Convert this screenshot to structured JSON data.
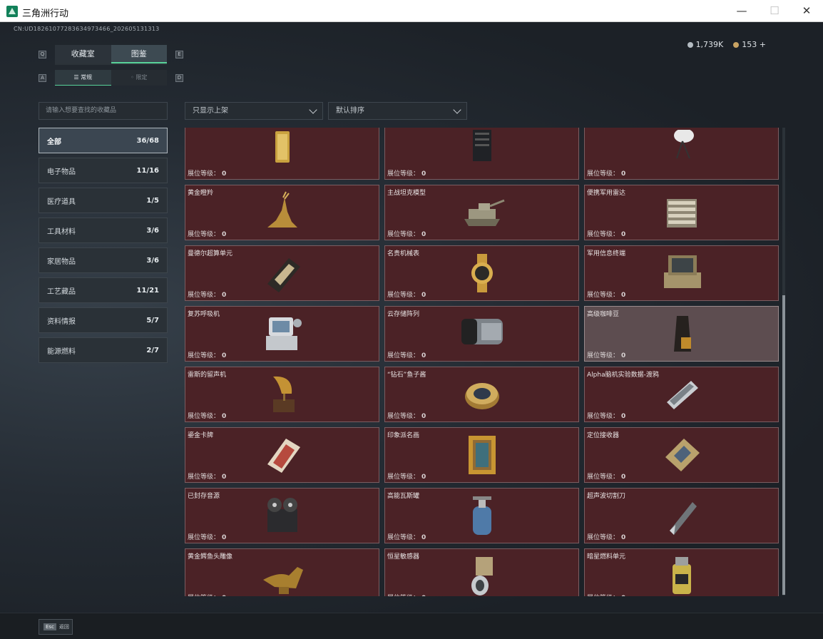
{
  "window": {
    "title": "三角洲行动"
  },
  "uid": "CN:UD18261077283634973466_202605131313",
  "currency": {
    "silver": "1,739K",
    "gold": "153"
  },
  "main_tabs": [
    {
      "label": "收藏室"
    },
    {
      "label": "图鉴"
    }
  ],
  "sub_tabs": [
    {
      "label": "常规"
    },
    {
      "label": "限定"
    }
  ],
  "hint_keys": {
    "q": "Q",
    "e": "E",
    "a": "A",
    "d": "D"
  },
  "search": {
    "placeholder": "请输入想要查找的收藏品"
  },
  "filters": {
    "shelf": "只显示上架",
    "sort": "默认排序"
  },
  "categories": [
    {
      "name": "全部",
      "count": "36/68"
    },
    {
      "name": "电子物品",
      "count": "11/16"
    },
    {
      "name": "医疗道具",
      "count": "1/5"
    },
    {
      "name": "工具材料",
      "count": "3/6"
    },
    {
      "name": "家居物品",
      "count": "3/6"
    },
    {
      "name": "工艺藏品",
      "count": "11/21"
    },
    {
      "name": "资料情报",
      "count": "5/7"
    },
    {
      "name": "能源燃料",
      "count": "2/7"
    }
  ],
  "level_label": "展位等级：",
  "items": [
    {
      "name": "",
      "level": "0",
      "icon": "gold-bar"
    },
    {
      "name": "",
      "level": "0",
      "icon": "server-rack"
    },
    {
      "name": "",
      "level": "0",
      "icon": "satellite-dish"
    },
    {
      "name": "黄金瞪羚",
      "level": "0",
      "icon": "golden-gazelle"
    },
    {
      "name": "主战坦克模型",
      "level": "0",
      "icon": "tank-model"
    },
    {
      "name": "便携军用雷达",
      "level": "0",
      "icon": "military-radar"
    },
    {
      "name": "曼德尔超算单元",
      "level": "0",
      "icon": "supercomputing-unit"
    },
    {
      "name": "名贵机械表",
      "level": "0",
      "icon": "luxury-watch"
    },
    {
      "name": "军用信息终端",
      "level": "0",
      "icon": "military-terminal"
    },
    {
      "name": "复苏呼吸机",
      "level": "0",
      "icon": "ventilator"
    },
    {
      "name": "云存储阵列",
      "level": "0",
      "icon": "storage-array"
    },
    {
      "name": "高级咖啡豆",
      "level": "0",
      "icon": "coffee-beans"
    },
    {
      "name": "雷斯的留声机",
      "level": "0",
      "icon": "gramophone"
    },
    {
      "name": "“钻石”鱼子酱",
      "level": "0",
      "icon": "caviar-tin"
    },
    {
      "name": "Alpha脑机实验数据-渡鸦",
      "level": "0",
      "icon": "data-capsule"
    },
    {
      "name": "鎏金卡牌",
      "level": "0",
      "icon": "gilded-card"
    },
    {
      "name": "印象派名画",
      "level": "0",
      "icon": "framed-painting"
    },
    {
      "name": "定位接收器",
      "level": "0",
      "icon": "positioning-receiver"
    },
    {
      "name": "已封存音源",
      "level": "0",
      "icon": "reel-recorder"
    },
    {
      "name": "高能瓦斯罐",
      "level": "0",
      "icon": "gas-canister"
    },
    {
      "name": "超声波切割刀",
      "level": "0",
      "icon": "ultrasonic-cutter"
    },
    {
      "name": "黄金鳄鱼头雕像",
      "level": "0",
      "icon": "crocodile-statue"
    },
    {
      "name": "恒星敏感器",
      "level": "0",
      "icon": "star-sensor"
    },
    {
      "name": "暗星燃料单元",
      "level": "0",
      "icon": "fuel-cell"
    }
  ],
  "bottom": {
    "esc_key": "Esc",
    "back_label": "返回"
  },
  "colors": {
    "accent": "#58d39a",
    "card_bg": "#4b2226",
    "card_selected": "#5d4d50"
  }
}
